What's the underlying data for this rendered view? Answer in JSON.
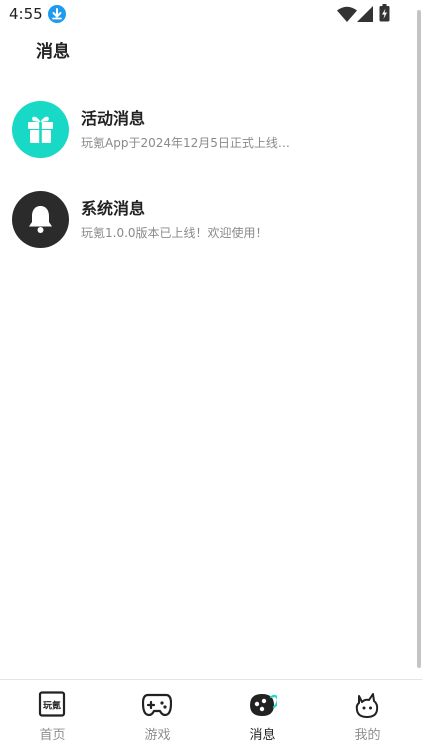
{
  "status_bar": {
    "time": "4:55",
    "icons": [
      "download-icon",
      "wifi-icon",
      "signal-icon",
      "battery-icon"
    ]
  },
  "page": {
    "title": "消息"
  },
  "messages": [
    {
      "title": "活动消息",
      "description": "玩氪App于2024年12月5日正式上线…",
      "icon": "gift-icon",
      "color": "#18d9c6"
    },
    {
      "title": "系统消息",
      "description": "玩氪1.0.0版本已上线！欢迎使用！",
      "icon": "bell-icon",
      "color": "#2b2b2b"
    }
  ],
  "tab_bar": {
    "active": 2,
    "tabs": [
      {
        "label": "首页",
        "icon": "home-logo-icon",
        "logo_text": "玩氪"
      },
      {
        "label": "游戏",
        "icon": "gamepad-icon"
      },
      {
        "label": "消息",
        "icon": "message-icon"
      },
      {
        "label": "我的",
        "icon": "profile-icon"
      }
    ]
  },
  "colors": {
    "accent": "#18d9c6",
    "text_primary": "#222222",
    "text_secondary": "#8a8a8a"
  }
}
